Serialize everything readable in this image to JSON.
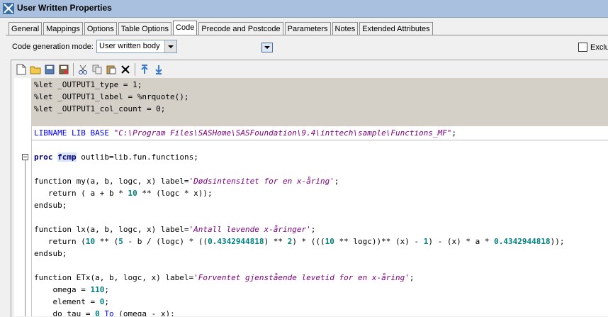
{
  "window": {
    "title": "User Written Properties"
  },
  "tabs": [
    "General",
    "Mappings",
    "Options",
    "Table Options",
    "Code",
    "Precode and Postcode",
    "Parameters",
    "Notes",
    "Extended Attributes"
  ],
  "active_tab": "Code",
  "mode": {
    "label": "Code generation mode:",
    "value": "User written body"
  },
  "exclude_label": "Exclu",
  "toolbar_icons": [
    "new-file-icon",
    "open-folder-icon",
    "save-icon",
    "save-as-icon",
    "cut-icon",
    "copy-icon",
    "paste-icon",
    "delete-icon",
    "move-up-icon",
    "move-down-icon"
  ],
  "code": {
    "l1": "%let _OUTPUT1_type = 1;",
    "l2": "%let _OUTPUT1_label = %nrquote();",
    "l3": "%let _OUTPUT1_col_count = 0;",
    "lib_kw": "LIBNAME LIB BASE ",
    "lib_path": "\"C:\\Program Files\\SASHome\\SASFoundation\\9.4\\inttech\\sample\\Functions_MF\"",
    "lib_end": ";",
    "proc": "proc",
    "fcmp": "fcmp",
    "proc_rest": " outlib=lib.fun.functions;",
    "f1_head": "function my(a, b, logc, x) label=",
    "f1_label": "'Dødsintensitet for en x-åring'",
    "f1_ret_a": "   return ( a + b * ",
    "f1_ret_n": "10",
    "f1_ret_b": " ** (logc * x));",
    "endsub": "endsub;",
    "f2_head": "function lx(a, b, logc, x) label=",
    "f2_label": "'Antall levende x-åringer'",
    "f2_r1": "   return (",
    "f2_n1": "10",
    "f2_r2": " ** (",
    "f2_n2": "5",
    "f2_r3": " - b / (logc) * ((",
    "f2_n3": "0.4342944818",
    "f2_r4": ") ** ",
    "f2_n4": "2",
    "f2_r5": ") * (((",
    "f2_n5": "10",
    "f2_r6": " ** logc))** (x) - ",
    "f2_n6": "1",
    "f2_r7": ") - (x) * a * ",
    "f2_n7": "0.4342944818",
    "f2_r8": "));",
    "f3_head": "function ETx(a, b, logc, x) label=",
    "f3_label": "'Forventet gjenstående levetid for en x-åring'",
    "omega_a": "    omega = ",
    "omega_n": "110",
    "elem_a": "    element = ",
    "elem_n": "0",
    "do_a": "    do tau = ",
    "do_n": "0",
    "do_kw": " To",
    "do_b": " (omega - x);"
  }
}
